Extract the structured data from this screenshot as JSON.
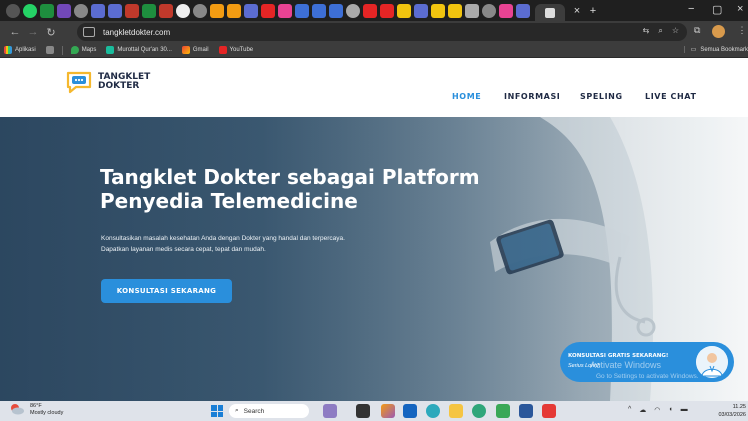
{
  "browser": {
    "url": "tangkletdokter.com",
    "colors": {
      "frame": "#1f1f1f",
      "toolbar": "#3c3c3c",
      "omnibox": "#282828"
    }
  },
  "bookmarks": {
    "items": [
      {
        "label": "Aplikasi",
        "icon": "apps-grid-icon"
      },
      {
        "label": "Maps",
        "icon": "maps-pin-icon"
      },
      {
        "label": "Murottal Qur'an 30...",
        "icon": "q-app-icon"
      },
      {
        "label": "Gmail",
        "icon": "gmail-icon"
      },
      {
        "label": "YouTube",
        "icon": "youtube-icon"
      }
    ],
    "all_bookmarks": "Semua Bookmark"
  },
  "site": {
    "logo_line1": "TANGKLET",
    "logo_line2": "DOKTER",
    "nav": [
      "HOME",
      "INFORMASI",
      "SPELING",
      "LIVE CHAT"
    ],
    "active_nav": "HOME",
    "hero_title": "Tangklet Dokter sebagai Platform Penyedia Telemedicine",
    "hero_subtitle_1": "Konsultasikan masalah kesehatan Anda dengan Dokter yang handal dan terpercaya.",
    "hero_subtitle_2": "Dapatkan layanan medis secara cepat, tepat dan mudah.",
    "cta_label": "KONSULTASI SEKARANG",
    "chat_title": "KONSULTASI GRATIS SEKARANG!",
    "chat_subtitle": "Serius Lohhh",
    "accent_color": "#2a8fdc",
    "text_dark": "#1f2a44"
  },
  "watermark": {
    "line1": "Activate Windows",
    "line2": "Go to Settings to activate Windows."
  },
  "taskbar": {
    "temperature": "86°F",
    "weather": "Mostly cloudy",
    "search_placeholder": "Search",
    "time": "11.25",
    "date": "03/03/2026"
  }
}
